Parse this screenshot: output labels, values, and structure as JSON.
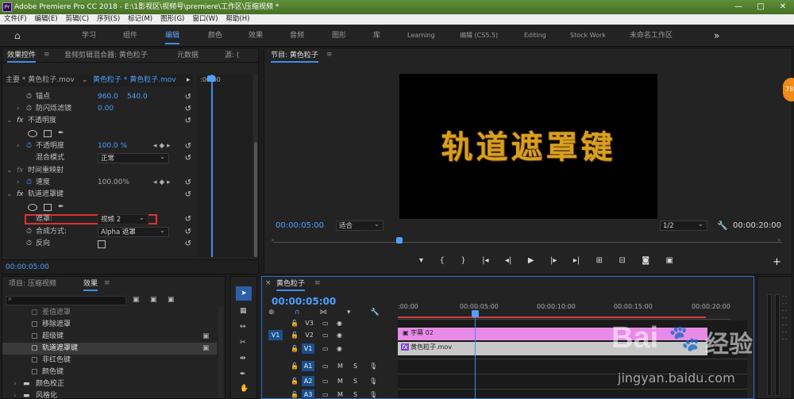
{
  "titlebar": {
    "app_logo": "Pr",
    "title": "Adobe Premiere Pro CC 2018 - E:\\1影视区\\视频号\\premiere\\工作区\\压缩视频 *",
    "minimize": "—",
    "maximize": "□",
    "close": "✕"
  },
  "menu": [
    "文件(F)",
    "编辑(E)",
    "剪辑(C)",
    "序列(S)",
    "标记(M)",
    "图形(G)",
    "窗口(W)",
    "帮助(H)"
  ],
  "workspaces": {
    "items": [
      "学习",
      "组件",
      "编辑",
      "颜色",
      "效果",
      "音频",
      "图形",
      "库",
      "Learning",
      "编辑 (CS5.5)",
      "Editing",
      "Stock Work",
      "未命名工作区"
    ],
    "active": "编辑",
    "more": "»"
  },
  "effect_controls": {
    "tabs": [
      "效果控件",
      "音频剪辑混合器: 黄色粒子",
      "元数据",
      "源: ("
    ],
    "master_label": "主要 * 黄色粒子.mov",
    "clip_label": "黄色粒子 * 黄色粒子.mov",
    "ruler_start": ":00:00",
    "anchor_label": "锚点",
    "anchor_x": "960.0",
    "anchor_y": "540.0",
    "antiflicker_label": "防闪烁滤镜",
    "antiflicker_value": "0.00",
    "opacity_group": "不透明度",
    "opacity_label": "不透明度",
    "opacity_value": "100.0 %",
    "blend_label": "混合模式",
    "blend_value": "正常",
    "timeremap_group": "时间重映射",
    "speed_label": "速度",
    "speed_value": "100.00%",
    "trackmatte_group": "轨道遮罩键",
    "matte_label": "遮罩:",
    "matte_value": "视频 2",
    "composite_label": "合成方式:",
    "composite_value": "Alpha 遮罩",
    "reverse_label": "反向",
    "timecode": "00:00:05:00",
    "fx": "fx"
  },
  "program_monitor": {
    "title": "节目: 黄色粒子",
    "video_text": "轨道遮罩键",
    "timecode": "00:00:05:00",
    "fit_value": "适合",
    "resolution": "1/2",
    "duration": "00:00:20:00",
    "add_button": "+",
    "badge": "78"
  },
  "project_panel": {
    "tabs": [
      "项目: 压缩视频",
      "效果"
    ],
    "items": [
      "差值遮罩",
      "移除遮罩",
      "超级键",
      "轨道遮罩键",
      "非红色键",
      "颜色键",
      "颜色校正",
      "风格化"
    ],
    "highlighted": "轨道遮罩键"
  },
  "timeline": {
    "title": "黄色粒子",
    "timecode": "00:00:05:00",
    "ruler": [
      ":00:00",
      "00:00:05:00",
      "00:00:10:00",
      "00:00:15:00",
      "00:00:20:00"
    ],
    "tracks": [
      {
        "src": "",
        "name": "V3"
      },
      {
        "src": "V1",
        "name": "V2"
      },
      {
        "src": "",
        "name": "V1"
      },
      {
        "src": "",
        "name": "A1"
      },
      {
        "src": "",
        "name": "A2"
      },
      {
        "src": "",
        "name": "A3"
      }
    ],
    "mute": "M",
    "solo": "S",
    "clip_v2": "字幕 02",
    "clip_v1": "黄色粒子.mov",
    "fx_badge": "fx"
  },
  "watermark": {
    "brand": "Bai",
    "brand2": "经验",
    "url": "jingyan.baidu.com"
  },
  "colors": {
    "accent_blue": "#3d8fe8",
    "clip_pink": "#e88be8",
    "clip_gray": "#c8c8c8",
    "title_gold": "#d8a020",
    "highlight_red": "#e03030"
  }
}
